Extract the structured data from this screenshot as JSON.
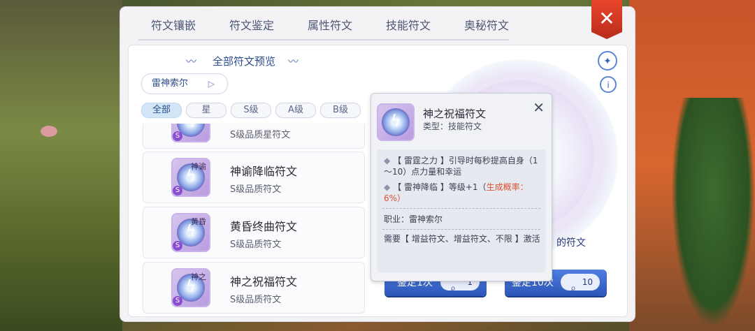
{
  "tabs": [
    {
      "label": "符文镶嵌",
      "active": false
    },
    {
      "label": "符文鉴定",
      "active": true
    },
    {
      "label": "属性符文",
      "active": false
    },
    {
      "label": "技能符文",
      "active": false
    },
    {
      "label": "奥秘符文",
      "active": false
    }
  ],
  "preview": {
    "title": "全部符文预览",
    "deco_left": "〰",
    "deco_right": "〰"
  },
  "character_select": {
    "value": "雷神索尔"
  },
  "filters": [
    "全部",
    "星",
    "S级",
    "A级",
    "B级"
  ],
  "rune_list": [
    {
      "icon_tag": "",
      "name": "",
      "sub": "S级品质星符文",
      "badge": "S"
    },
    {
      "icon_tag": "神谕",
      "name": "神谕降临符文",
      "sub": "S级品质符文",
      "badge": "S"
    },
    {
      "icon_tag": "黄昏",
      "name": "黄昏终曲符文",
      "sub": "S级品质符文",
      "badge": "S"
    },
    {
      "icon_tag": "神之",
      "name": "神之祝福符文",
      "sub": "S级品质符文",
      "badge": "S"
    }
  ],
  "tooltip": {
    "name": "神之祝福符文",
    "type": "类型：技能符文",
    "effect1": "【 雷霆之力 】引导时每秒提高自身（1～10）点力量和幸运",
    "effect2_main": "【 雷神降临 】等级+1（",
    "effect2_red": "生成概率：6%）",
    "job": "职业：雷神索尔",
    "requirement": "需要【 增益符文、增益符文、不限 】激活"
  },
  "right_panel": {
    "hint_fragment": "的符文"
  },
  "buttons": {
    "identify_once": {
      "label": "鉴定1次",
      "count": "1"
    },
    "identify_ten": {
      "label": "鉴定10次",
      "count": "10"
    }
  },
  "icons": {
    "close": "close-icon",
    "wand": "magic-wand-icon",
    "info": "info-icon"
  },
  "colors": {
    "accent": "#2c55b8",
    "close_banner": "#d83a24",
    "highlight_red": "#d9502e"
  }
}
